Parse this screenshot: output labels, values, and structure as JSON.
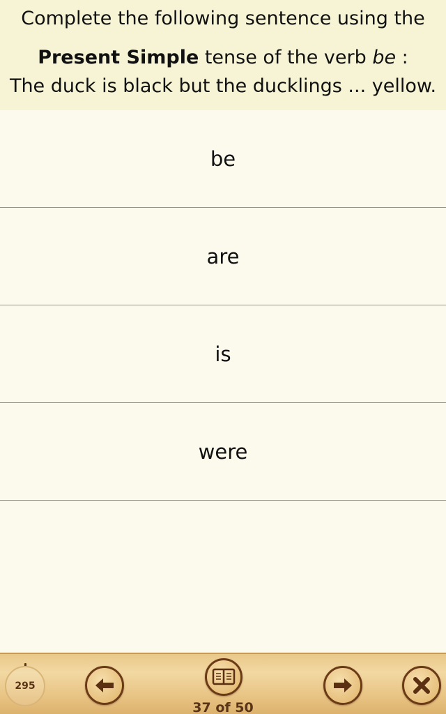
{
  "question": {
    "line1": "Complete the following sentence using the",
    "line2_bold": "Present Simple",
    "line2_middle": " tense of the verb ",
    "line2_italic": "be",
    "line2_end": " :",
    "line3": "The duck is black but the ducklings ... yellow."
  },
  "answers": [
    {
      "label": "be"
    },
    {
      "label": "are"
    },
    {
      "label": "is"
    },
    {
      "label": "were"
    }
  ],
  "toolbar": {
    "score": "295",
    "counter": "37 of 50",
    "icons": {
      "prev": "arrow-left-icon",
      "book": "book-icon",
      "next": "arrow-right-icon",
      "close": "close-icon"
    }
  },
  "colors": {
    "question_bg": "#f6f4d5",
    "page_bg": "#fcf9ed",
    "toolbar_bg": "#e9c98a",
    "icon_dark": "#6b3a16"
  }
}
